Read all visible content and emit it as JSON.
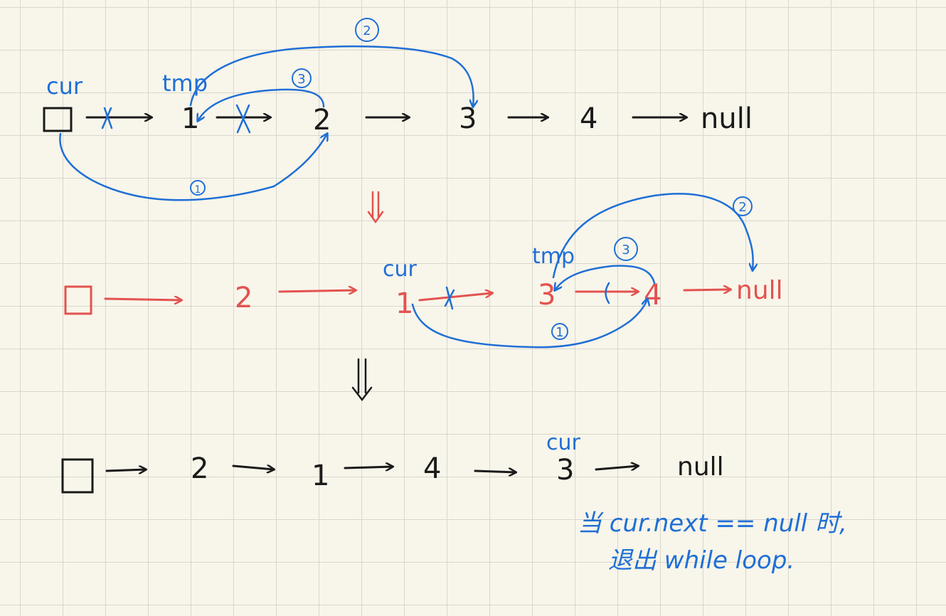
{
  "colors": {
    "ink": "#1a1a1a",
    "red": "#e3524f",
    "blue": "#1f6fd6"
  },
  "row1": {
    "nodes": [
      "1",
      "2",
      "3",
      "4",
      "null"
    ],
    "cur_label": "cur",
    "tmp_label": "tmp",
    "step_labels": [
      "1",
      "2",
      "3"
    ]
  },
  "row2": {
    "nodes": [
      "2",
      "1",
      "3",
      "4",
      "null"
    ],
    "cur_label": "cur",
    "tmp_label": "tmp",
    "step_labels": [
      "1",
      "2",
      "3"
    ]
  },
  "row3": {
    "nodes": [
      "2",
      "1",
      "4",
      "3",
      "null"
    ],
    "cur_label": "cur"
  },
  "note": {
    "line1": "当 cur.next == null 时,",
    "line2": "退出 while loop."
  }
}
